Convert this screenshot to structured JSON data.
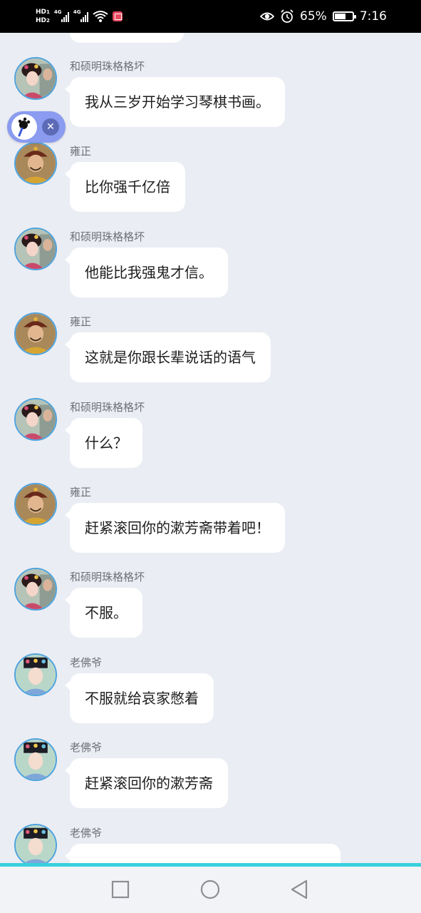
{
  "status_bar": {
    "hd1": "HD",
    "hd1_sub": "1",
    "hd2": "HD",
    "hd2_sub": "2",
    "net1": "4G",
    "net2": "4G",
    "battery_percent": "65%",
    "battery_level": 0.65,
    "time": "7:16",
    "icons": [
      "hd-icon",
      "signal-icon",
      "signal-icon",
      "wifi-icon",
      "app-notification-icon",
      "eye-comfort-icon",
      "alarm-icon",
      "battery-charging-icon"
    ]
  },
  "messages": [
    {
      "sender": "和硕明珠格格坏",
      "text": "我从三岁开始学习琴棋书画。",
      "avatar": "princess"
    },
    {
      "sender": "雍正",
      "text": "比你强千亿倍",
      "avatar": "emperor"
    },
    {
      "sender": "和硕明珠格格坏",
      "text": "他能比我强鬼才信。",
      "avatar": "princess"
    },
    {
      "sender": "雍正",
      "text": "这就是你跟长辈说话的语气",
      "avatar": "emperor"
    },
    {
      "sender": "和硕明珠格格坏",
      "text": "什么？",
      "avatar": "princess"
    },
    {
      "sender": "雍正",
      "text": "赶紧滚回你的漱芳斋带着吧！",
      "avatar": "emperor"
    },
    {
      "sender": "和硕明珠格格坏",
      "text": "不服。",
      "avatar": "princess"
    },
    {
      "sender": "老佛爷",
      "text": "不服就给哀家憋着",
      "avatar": "empress"
    },
    {
      "sender": "老佛爷",
      "text": "赶紧滚回你的漱芳斋",
      "avatar": "empress"
    },
    {
      "sender": "老佛爷",
      "text": "",
      "avatar": "empress"
    }
  ],
  "float_widget": {
    "icon": "floating-app-icon",
    "close_icon": "close-icon",
    "close_glyph": "✕"
  },
  "nav_bar": {
    "icons": [
      "recent-apps-icon",
      "home-icon",
      "back-icon"
    ]
  },
  "colors": {
    "chat_background": "#eaedf3",
    "bubble": "#ffffff",
    "avatar_ring": "#4ea3de",
    "nav_accent": "#39d0dd",
    "float_widget": "#8a9bf0"
  }
}
